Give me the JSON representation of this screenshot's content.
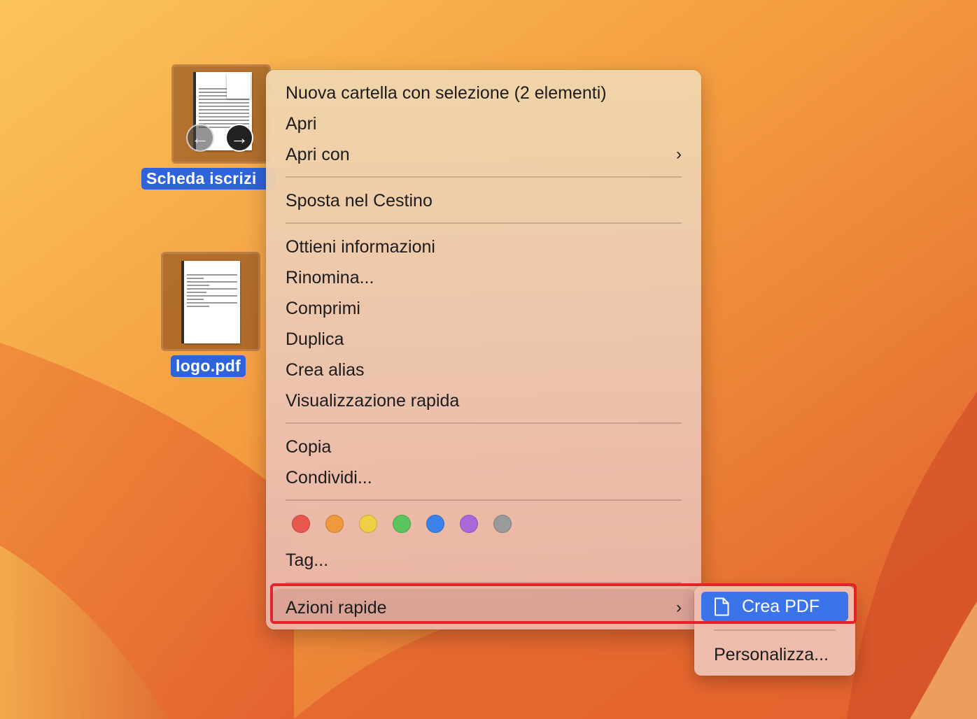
{
  "desktop": {
    "icons": [
      {
        "label": "Scheda iscrizi"
      },
      {
        "label": "logo.pdf"
      }
    ]
  },
  "context_menu": {
    "items": [
      {
        "label": "Nuova cartella con selezione (2 elementi)"
      },
      {
        "label": "Apri"
      },
      {
        "label": "Apri con",
        "chevron": "›"
      },
      {
        "label": "Sposta nel Cestino"
      },
      {
        "label": "Ottieni informazioni"
      },
      {
        "label": "Rinomina..."
      },
      {
        "label": "Comprimi"
      },
      {
        "label": "Duplica"
      },
      {
        "label": "Crea alias"
      },
      {
        "label": "Visualizzazione rapida"
      },
      {
        "label": "Copia"
      },
      {
        "label": "Condividi..."
      },
      {
        "label": "Tag..."
      },
      {
        "label": "Azioni rapide",
        "chevron": "›"
      }
    ],
    "tag_colors": [
      {
        "name": "red",
        "color": "#e8584e"
      },
      {
        "name": "orange",
        "color": "#ee9a3c"
      },
      {
        "name": "yellow",
        "color": "#f0cf44"
      },
      {
        "name": "green",
        "color": "#5cc45c"
      },
      {
        "name": "blue",
        "color": "#3d82ea"
      },
      {
        "name": "purple",
        "color": "#a968d8"
      },
      {
        "name": "gray",
        "color": "#9a9a9a"
      }
    ]
  },
  "submenu": {
    "items": [
      {
        "label": "Crea PDF"
      },
      {
        "label": "Personalizza..."
      }
    ]
  },
  "colors": {
    "selection": "#3b74e8",
    "annotation": "#e0242a"
  }
}
